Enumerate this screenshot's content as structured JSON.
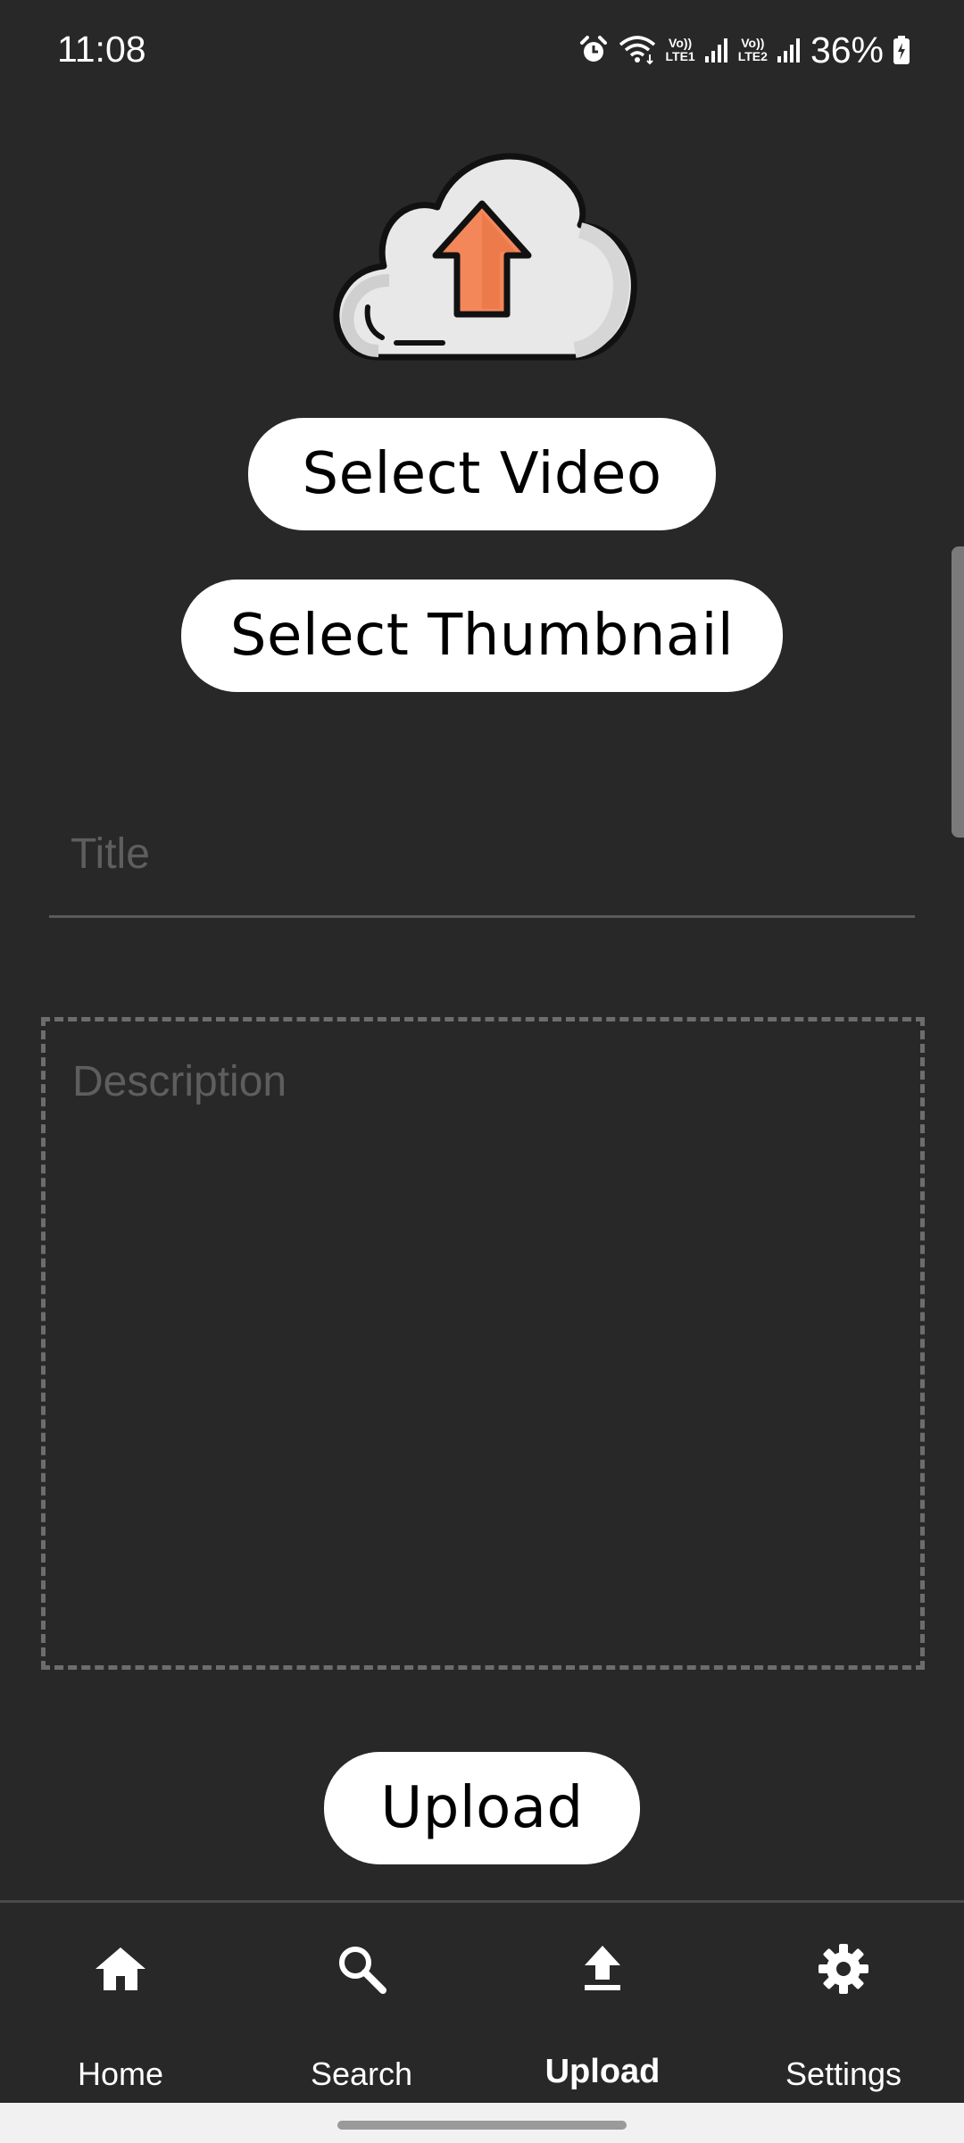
{
  "status_bar": {
    "time": "11:08",
    "battery_percent": "36%",
    "sim1_top": "Vo))",
    "sim1_bottom": "LTE1",
    "sim2_top": "Vo))",
    "sim2_bottom": "LTE2",
    "icons": [
      "alarm-icon",
      "wifi-icon",
      "signal-icon",
      "signal-icon",
      "battery-charging-icon"
    ]
  },
  "upload_form": {
    "illustration": "cloud-upload-icon",
    "select_video_label": "Select Video",
    "select_thumbnail_label": "Select Thumbnail",
    "title_placeholder": "Title",
    "description_placeholder": "Description",
    "upload_label": "Upload"
  },
  "bottom_nav": {
    "items": [
      {
        "label": "Home",
        "icon": "home-icon"
      },
      {
        "label": "Search",
        "icon": "search-icon"
      },
      {
        "label": "Upload",
        "icon": "upload-icon",
        "active": true
      },
      {
        "label": "Settings",
        "icon": "gear-icon"
      }
    ]
  },
  "colors": {
    "background": "#282828",
    "button_bg": "#ffffff",
    "button_text": "#000000",
    "arrow_orange": "#f4875a",
    "placeholder": "#5e5e5e"
  }
}
